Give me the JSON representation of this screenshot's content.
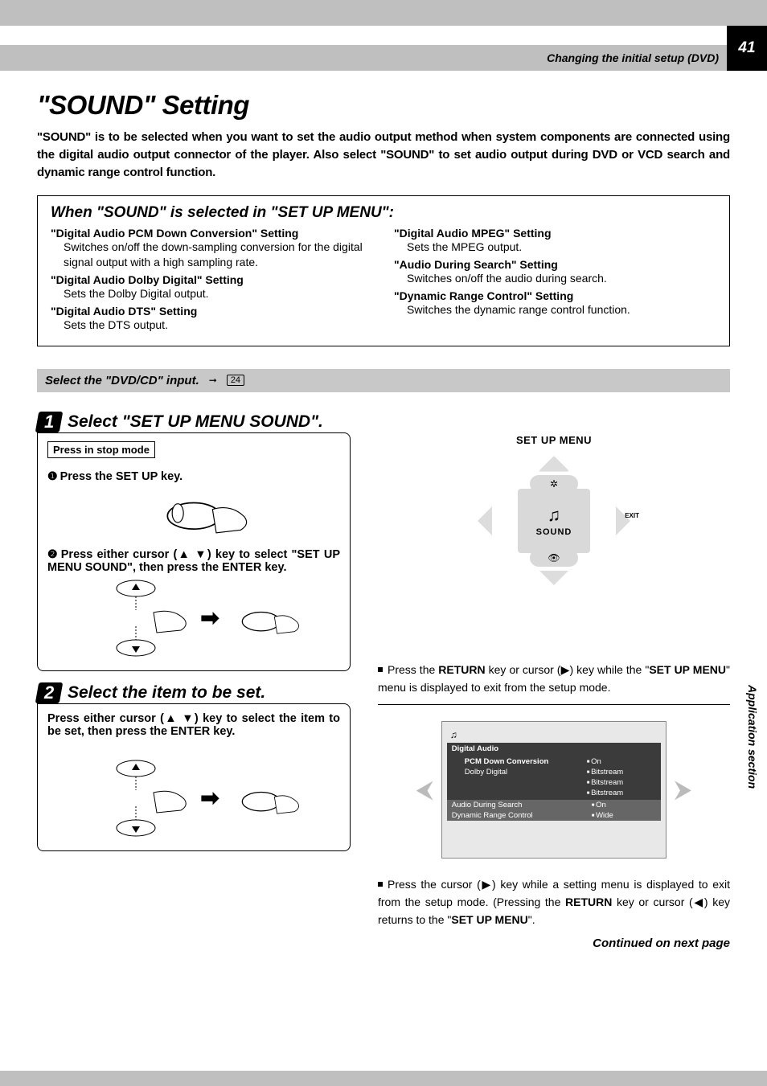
{
  "page_number": "41",
  "header_title": "Changing the initial setup (DVD)",
  "side_label": "Application section",
  "main_title": "\"SOUND\" Setting",
  "intro": "\"SOUND\" is to be selected when you want to set the audio output method when system components are connected using the digital audio output connector of the player. Also select \"SOUND\" to set audio output during DVD or VCD search and dynamic range control function.",
  "box_heading": "When \"SOUND\" is selected in \"SET UP MENU\":",
  "settings_left": [
    {
      "t": "\"Digital Audio PCM Down Conversion\" Setting",
      "d": "Switches on/off the down-sampling conversion for the digital signal output with a high sampling rate."
    },
    {
      "t": "\"Digital Audio Dolby Digital\" Setting",
      "d": "Sets the Dolby Digital output."
    },
    {
      "t": "\"Digital Audio DTS\" Setting",
      "d": "Sets the DTS output."
    }
  ],
  "settings_right": [
    {
      "t": "\"Digital Audio MPEG\" Setting",
      "d": "Sets the MPEG output."
    },
    {
      "t": "\"Audio During Search\" Setting",
      "d": "Switches on/off the audio during search."
    },
    {
      "t": "\"Dynamic Range Control\" Setting",
      "d": "Switches the dynamic range control function."
    }
  ],
  "graybar_text": "Select the \"DVD/CD\" input.",
  "ref_page": "24",
  "step1": {
    "num": "1",
    "title": "Select \"SET UP MENU SOUND\".",
    "press_box": "Press in stop mode",
    "sub1": "Press the SET UP key.",
    "sub2": "Press either cursor (▲ ▼) key to select \"SET UP MENU SOUND\", then press the ENTER key."
  },
  "step2": {
    "num": "2",
    "title": "Select the item to be set.",
    "body": "Press either cursor (▲ ▼) key to select the item to be set, then press the ENTER key."
  },
  "menu": {
    "title": "SET UP MENU",
    "center": "SOUND",
    "exit": "EXIT"
  },
  "note1_pre": "Press the ",
  "note1_b1": "RETURN",
  "note1_mid": " key or cursor (▶) key while the \"",
  "note1_b2": "SET UP MENU",
  "note1_end": "\" menu is displayed to exit from the setup mode.",
  "sound_panel": {
    "group": "Digital Audio",
    "rows": [
      {
        "l": "PCM Down Conversion",
        "r": "On"
      },
      {
        "l": "Dolby Digital",
        "r": "Bitstream"
      },
      {
        "l": "",
        "r": "Bitstream"
      },
      {
        "l": "",
        "r": "Bitstream"
      }
    ],
    "strip1": {
      "l": "Audio During Search",
      "r": "On"
    },
    "strip2": {
      "l": "Dynamic Range Control",
      "r": "Wide"
    }
  },
  "note2_pre": "Press the cursor (▶) key while a setting menu is displayed to exit from the setup mode. (Pressing the ",
  "note2_b1": "RETURN",
  "note2_mid": " key or cursor (◀) key returns to the \"",
  "note2_b2": "SET UP MENU",
  "note2_end": "\".",
  "footer": "Continued on next page"
}
